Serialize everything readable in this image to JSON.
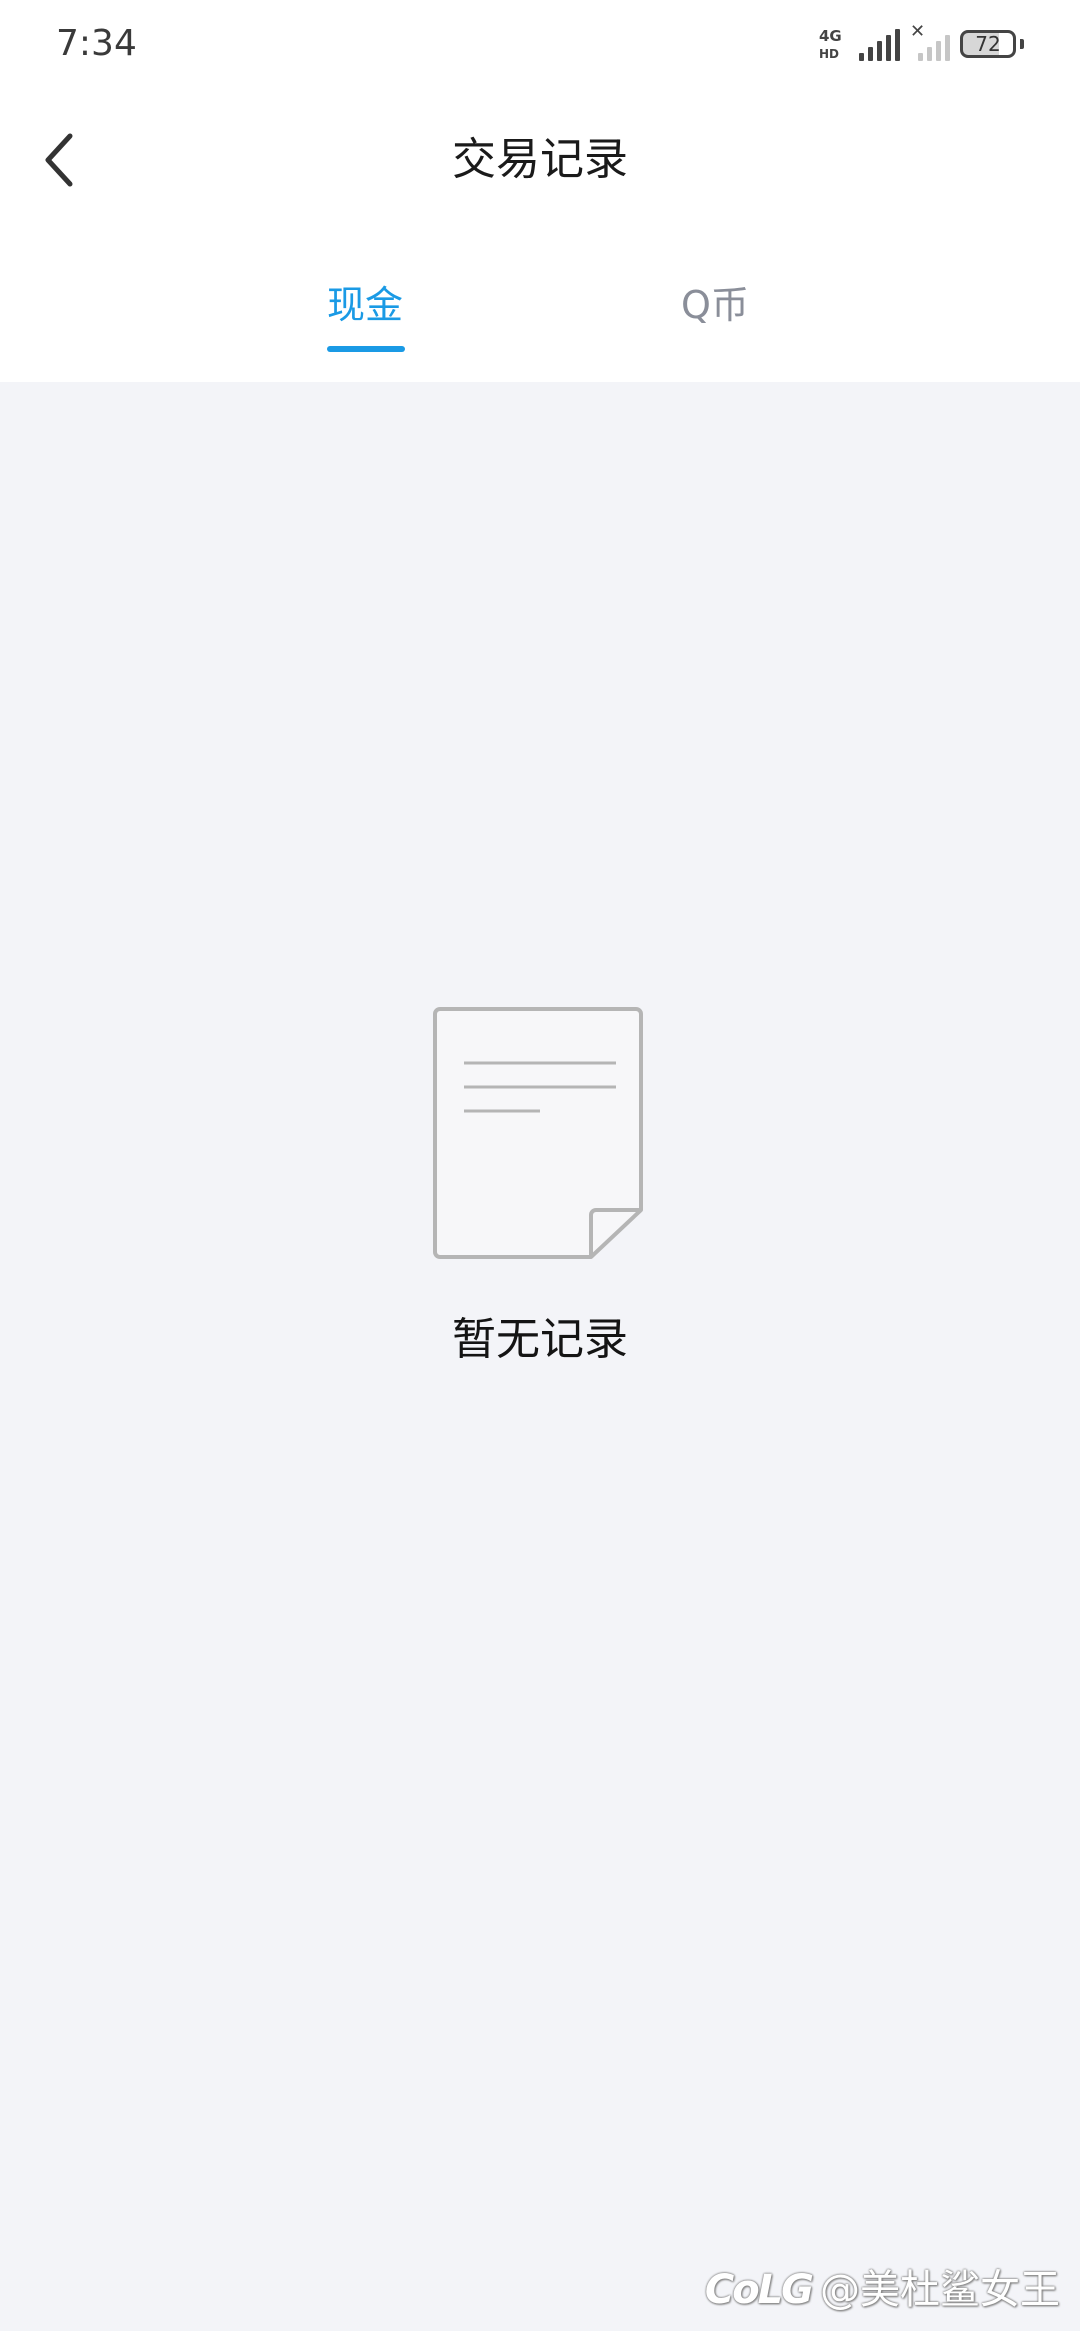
{
  "status_bar": {
    "time": "7:34",
    "network": "4G",
    "network_sub": "HD",
    "battery": "72"
  },
  "header": {
    "title": "交易记录"
  },
  "tabs": [
    {
      "label": "现金",
      "active": true
    },
    {
      "label": "Q币",
      "active": false
    }
  ],
  "empty_state": {
    "icon": "document-icon",
    "message": "暂无记录"
  },
  "watermark": {
    "logo": "CoLG",
    "text": "@美杜鲨女王"
  },
  "colors": {
    "accent": "#1a9ae5",
    "background": "#f3f4f8",
    "inactive_tab": "#8a8e99"
  }
}
